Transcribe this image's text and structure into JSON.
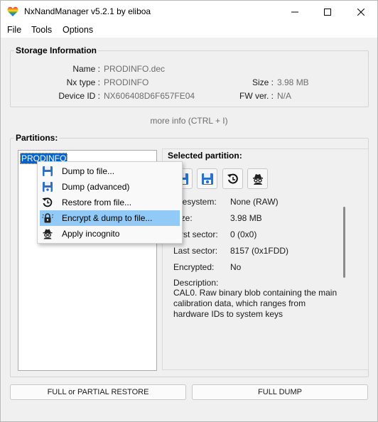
{
  "window": {
    "title": "NxNandManager v5.2.1 by eliboa"
  },
  "menu": [
    "File",
    "Tools",
    "Options"
  ],
  "storage": {
    "title": "Storage Information",
    "name_label": "Name :",
    "name_value": "PRODINFO.dec",
    "type_label": "Nx type :",
    "type_value": "PRODINFO",
    "device_label": "Device ID :",
    "device_value": "NX606408D6F657FE04",
    "size_label": "Size :",
    "size_value": "3.98 MB",
    "fw_label": "FW ver. :",
    "fw_value": "N/A",
    "more_info": "more info (CTRL + I)"
  },
  "partitions": {
    "title": "Partitions:",
    "items": [
      "PRODINFO"
    ]
  },
  "selected": {
    "title": "Selected partition:",
    "filesystem_label": "Filesystem:",
    "filesystem_value": "None (RAW)",
    "size_label": "Size:",
    "size_value": "3.98 MB",
    "first_label": "First sector:",
    "first_value": "0 (0x0)",
    "last_label": "Last sector:",
    "last_value": "8157 (0x1FDD)",
    "encrypted_label": "Encrypted:",
    "encrypted_value": "No",
    "description_label": "Description:",
    "description_value": "CAL0. Raw binary blob containing the main calibration data, which ranges from hardware IDs to system keys",
    "tools": [
      "save-icon",
      "save-advanced-icon",
      "restore-icon",
      "incognito-icon"
    ]
  },
  "context_menu": {
    "items": [
      {
        "label": "Dump to file...",
        "icon": "save-icon"
      },
      {
        "label": "Dump (advanced)",
        "icon": "save-advanced-icon"
      },
      {
        "label": "Restore from file...",
        "icon": "restore-icon"
      },
      {
        "label": "Encrypt & dump to file...",
        "icon": "encrypt-icon"
      },
      {
        "label": "Apply incognito",
        "icon": "incognito-icon"
      }
    ],
    "active_index": 3
  },
  "buttons": {
    "restore": "FULL or PARTIAL RESTORE",
    "dump": "FULL DUMP"
  },
  "colors": {
    "accent": "#0a62c4",
    "menu_highlight": "#91c9f7"
  }
}
